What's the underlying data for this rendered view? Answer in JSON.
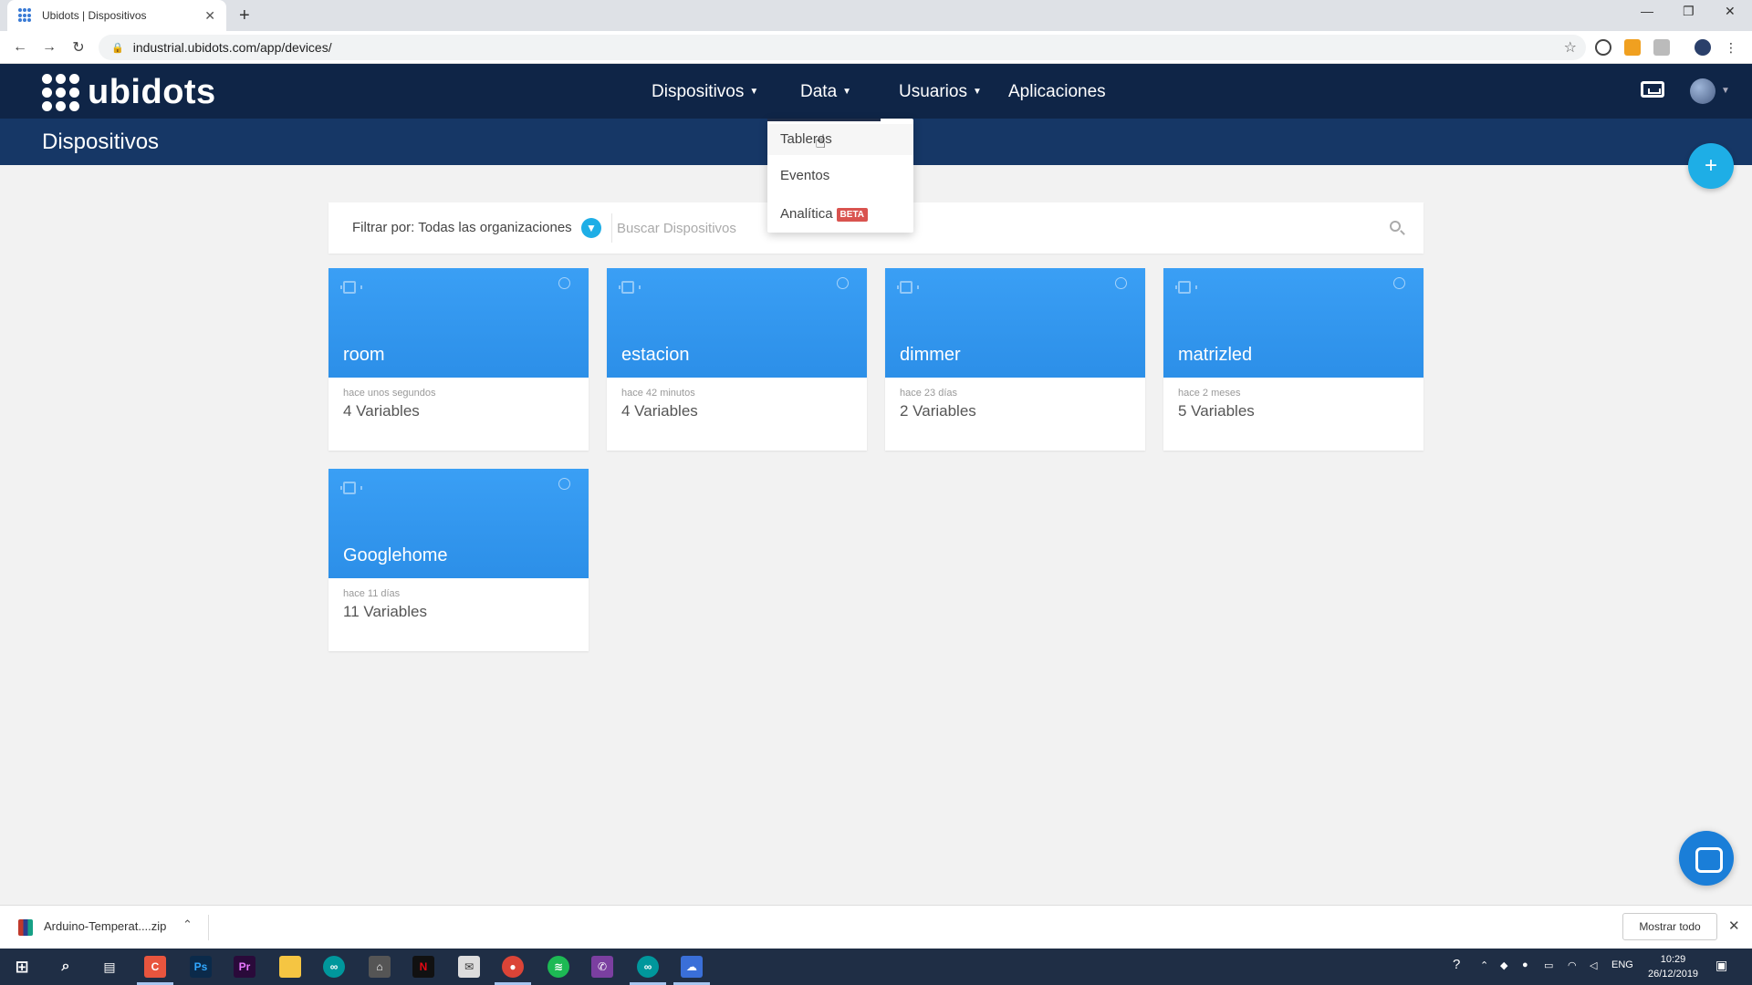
{
  "browser": {
    "tab_title": "Ubidots | Dispositivos",
    "tab_close": "✕",
    "new_tab": "+",
    "url": "industrial.ubidots.com/app/devices/"
  },
  "header": {
    "logo_text": "ubidots",
    "nav": [
      {
        "label": "Dispositivos",
        "has_caret": true
      },
      {
        "label": "Data",
        "has_caret": true
      },
      {
        "label": "Usuarios",
        "has_caret": true
      },
      {
        "label": "Aplicaciones",
        "has_caret": false
      }
    ],
    "page_title": "Dispositivos",
    "add_label": "+"
  },
  "data_menu": {
    "items": [
      {
        "label": "Tableros"
      },
      {
        "label": "Eventos"
      },
      {
        "label": "Analítica",
        "badge": "BETA"
      }
    ]
  },
  "filter": {
    "label": "Filtrar por: Todas las organizaciones",
    "search_placeholder": "Buscar Dispositivos"
  },
  "devices": [
    {
      "name": "room",
      "last_activity": "hace unos segundos",
      "variables": "4 Variables"
    },
    {
      "name": "estacion",
      "last_activity": "hace 42 minutos",
      "variables": "4 Variables"
    },
    {
      "name": "dimmer",
      "last_activity": "hace 23 días",
      "variables": "2 Variables"
    },
    {
      "name": "matrizled",
      "last_activity": "hace 2 meses",
      "variables": "5 Variables"
    },
    {
      "name": "Googlehome",
      "last_activity": "hace 11 días",
      "variables": "11 Variables"
    }
  ],
  "downloads": {
    "file_name": "Arduino-Temperat....zip",
    "show_all": "Mostrar todo"
  },
  "taskbar": {
    "language": "ENG",
    "time": "10:29",
    "date": "26/12/2019"
  },
  "colors": {
    "nav_bg": "#0f2547",
    "subheader_bg": "#163766",
    "card_blue": "#3a9ff5",
    "accent": "#1eaee6",
    "beta_badge": "#d9534f"
  }
}
